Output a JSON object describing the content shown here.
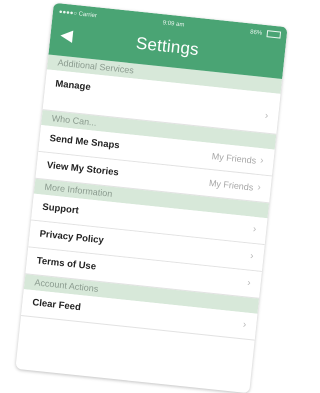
{
  "status_bar": {
    "carrier": "●●●●○ Carrier",
    "time": "9:09 am",
    "battery": "86%"
  },
  "header": {
    "back_icon": "chevron-left-icon",
    "title": "Settings"
  },
  "sections": [
    {
      "title": "Additional Services",
      "rows": [
        {
          "label": "Manage",
          "value": null,
          "tall": true
        }
      ]
    },
    {
      "title": "Who Can...",
      "rows": [
        {
          "label": "Send Me Snaps",
          "value": "My Friends"
        },
        {
          "label": "View My Stories",
          "value": "My Friends"
        }
      ]
    },
    {
      "title": "More Information",
      "rows": [
        {
          "label": "Support",
          "value": null
        },
        {
          "label": "Privacy Policy",
          "value": null
        },
        {
          "label": "Terms of Use",
          "value": null
        }
      ]
    },
    {
      "title": "Account Actions",
      "rows": [
        {
          "label": "Clear Feed",
          "value": null
        }
      ]
    }
  ],
  "colors": {
    "accent": "#4aa474",
    "section_bg": "#d7e8d9"
  }
}
